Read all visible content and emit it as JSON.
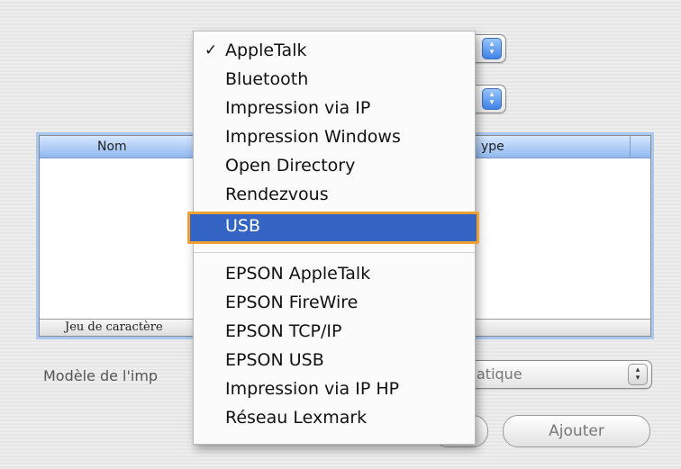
{
  "table": {
    "col_name": "Nom",
    "col_type": "ype",
    "footer": "Jeu de caractère"
  },
  "model_label": "Modèle de l'imp",
  "model_value": "atique",
  "add_button": "Ajouter",
  "menu": {
    "checkmark": "✓",
    "items_top": [
      "AppleTalk",
      "Bluetooth",
      "Impression via IP",
      "Impression Windows",
      "Open Directory",
      "Rendezvous"
    ],
    "selected": "USB",
    "items_bottom": [
      "EPSON AppleTalk",
      "EPSON FireWire",
      "EPSON TCP/IP",
      "EPSON USB",
      "Impression via IP HP",
      "Réseau Lexmark"
    ]
  },
  "colors": {
    "selection": "#3465c4",
    "highlight_border": "#f0a030",
    "aqua_blue": "#3f83e6"
  }
}
